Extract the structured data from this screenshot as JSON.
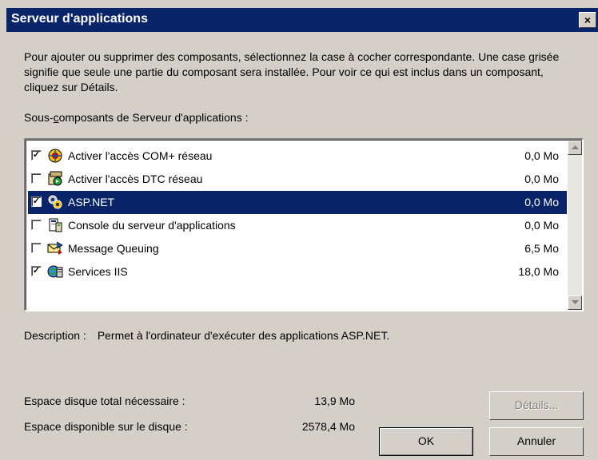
{
  "window": {
    "title": "Serveur d'applications",
    "close_label": "×"
  },
  "intro": {
    "text": "Pour ajouter ou supprimer des composants, sélectionnez la case à cocher correspondante. Une case grisée signifie que seule une partie du composant sera installée. Pour voir ce qui est inclus dans un composant, cliquez sur Détails."
  },
  "subcomponents": {
    "label_pre": "Sous-",
    "label_accel": "c",
    "label_post": "omposants de Serveur d'applications :",
    "items": [
      {
        "label": "Activer l'accès COM+ réseau",
        "size": "0,0 Mo",
        "checked": true,
        "selected": false,
        "icon": "com-network-icon"
      },
      {
        "label": "Activer l'accès DTC réseau",
        "size": "0,0 Mo",
        "checked": false,
        "selected": false,
        "icon": "dtc-network-icon"
      },
      {
        "label": "ASP.NET",
        "size": "0,0 Mo",
        "checked": true,
        "selected": true,
        "icon": "aspnet-icon"
      },
      {
        "label": "Console du serveur d'applications",
        "size": "0,0 Mo",
        "checked": false,
        "selected": false,
        "icon": "console-icon"
      },
      {
        "label": "Message Queuing",
        "size": "6,5 Mo",
        "checked": false,
        "selected": false,
        "icon": "message-queuing-icon"
      },
      {
        "label": "Services IIS",
        "size": "18,0 Mo",
        "checked": true,
        "selected": false,
        "icon": "iis-icon"
      }
    ]
  },
  "description": {
    "label": "Description :",
    "text": "Permet à l'ordinateur d'exécuter des applications ASP.NET."
  },
  "space": {
    "required_label": "Espace disque total nécessaire :",
    "required_value": "13,9 Mo",
    "available_label": "Espace disponible sur le disque :",
    "available_value": "2578,4 Mo"
  },
  "buttons": {
    "details": "Détails...",
    "ok": "OK",
    "cancel": "Annuler"
  },
  "colors": {
    "titlebar": "#0a246a",
    "selection": "#0a246a",
    "face": "#d4d0c8"
  }
}
